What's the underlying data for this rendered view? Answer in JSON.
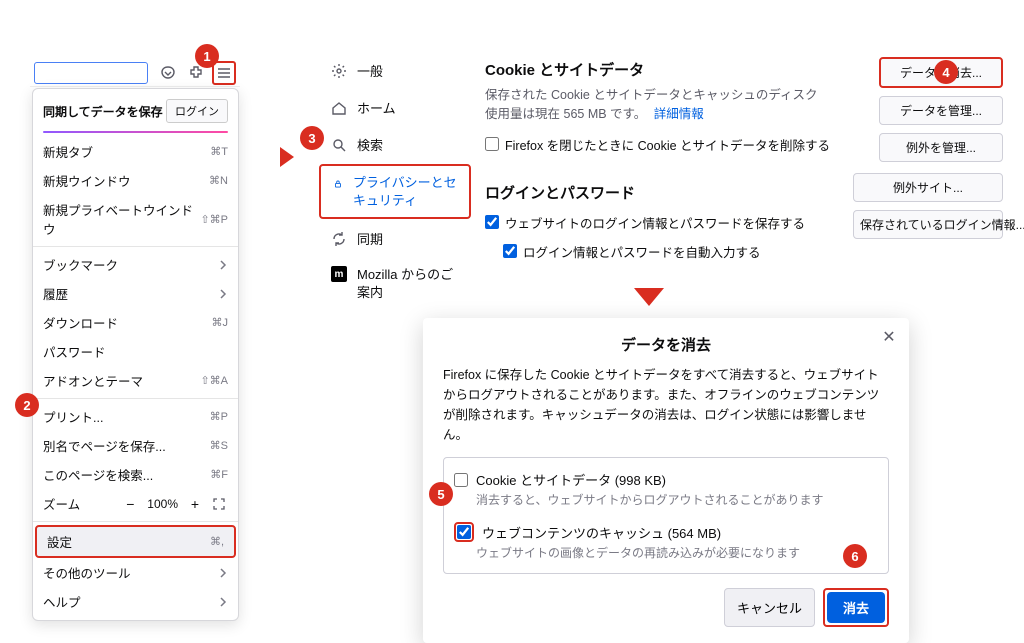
{
  "menu": {
    "sync_title": "同期してデータを保存",
    "login_btn": "ログイン",
    "new_tab": "新規タブ",
    "new_tab_sc": "⌘T",
    "new_window": "新規ウインドウ",
    "new_window_sc": "⌘N",
    "new_private": "新規プライベートウインドウ",
    "new_private_sc": "⇧⌘P",
    "bookmarks": "ブックマーク",
    "history": "履歴",
    "downloads": "ダウンロード",
    "downloads_sc": "⌘J",
    "passwords": "パスワード",
    "addons": "アドオンとテーマ",
    "addons_sc": "⇧⌘A",
    "print": "プリント...",
    "print_sc": "⌘P",
    "save_as": "別名でページを保存...",
    "save_as_sc": "⌘S",
    "find": "このページを検索...",
    "find_sc": "⌘F",
    "zoom": "ズーム",
    "zoom_pct": "100%",
    "settings": "設定",
    "settings_sc": "⌘,",
    "more_tools": "その他のツール",
    "help": "ヘルプ"
  },
  "nav": {
    "general": "一般",
    "home": "ホーム",
    "search": "検索",
    "privacy": "プライバシーとセキュリティ",
    "sync": "同期",
    "mozilla": "Mozilla からのご案内"
  },
  "cookies": {
    "heading": "Cookie とサイトデータ",
    "body_1": "保存された Cookie とサイトデータとキャッシュのディスク使用量は現在",
    "body_2": "565 MB です。",
    "more": "詳細情報",
    "del_on_close": "Firefox を閉じたときに Cookie とサイトデータを削除する",
    "btn_clear": "データを消去...",
    "btn_manage": "データを管理...",
    "btn_except": "例外を管理..."
  },
  "logins": {
    "heading": "ログインとパスワード",
    "save": "ウェブサイトのログイン情報とパスワードを保存する",
    "autofill": "ログイン情報とパスワードを自動入力する",
    "btn_except": "例外サイト...",
    "btn_saved": "保存されているログイン情報..."
  },
  "dialog": {
    "title": "データを消去",
    "body": "Firefox に保存した Cookie とサイトデータをすべて消去すると、ウェブサイトからログアウトされることがあります。また、オフラインのウェブコンテンツが削除されます。キャッシュデータの消去は、ログイン状態には影響しません。",
    "opt1_label": "Cookie とサイトデータ (998 KB)",
    "opt1_desc": "消去すると、ウェブサイトからログアウトされることがあります",
    "opt2_label": "ウェブコンテンツのキャッシュ (564 MB)",
    "opt2_desc": "ウェブサイトの画像とデータの再読み込みが必要になります",
    "cancel": "キャンセル",
    "clear": "消去"
  },
  "steps": {
    "1": "1",
    "2": "2",
    "3": "3",
    "4": "4",
    "5": "5",
    "6": "6"
  }
}
